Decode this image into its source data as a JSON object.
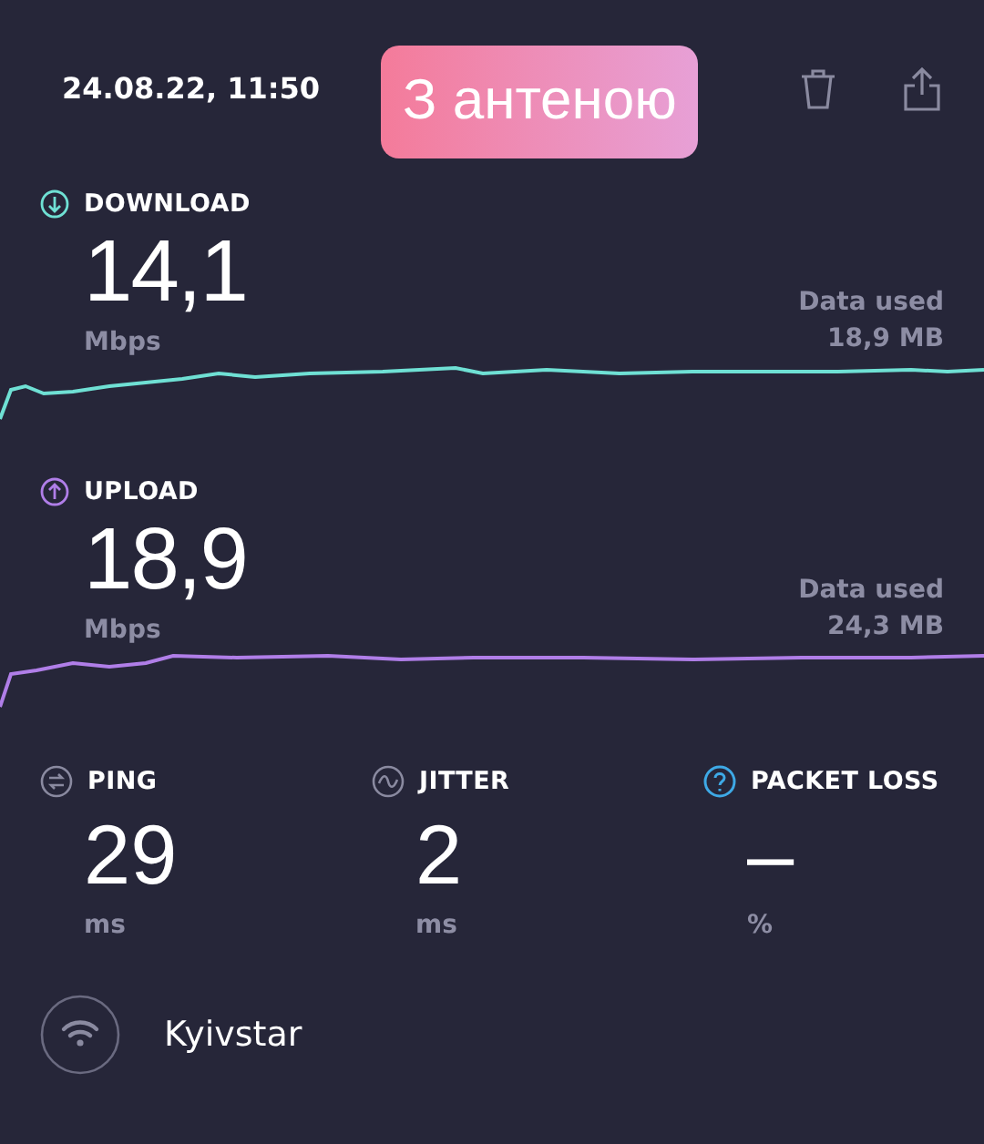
{
  "header": {
    "date": "24.08.22, 11:50",
    "banner": "З антеною"
  },
  "speeds": [
    {
      "kind": "download",
      "label": "DOWNLOAD",
      "value": "14,1",
      "unit": "Mbps",
      "data_label": "Data used",
      "data_value": "18,9 MB",
      "color": "#6fe0d4"
    },
    {
      "kind": "upload",
      "label": "UPLOAD",
      "value": "18,9",
      "unit": "Mbps",
      "data_label": "Data used",
      "data_value": "24,3 MB",
      "color": "#b07ee8"
    }
  ],
  "metrics": [
    {
      "kind": "ping",
      "label": "PING",
      "value": "29",
      "unit": "ms"
    },
    {
      "kind": "jitter",
      "label": "JITTER",
      "value": "2",
      "unit": "ms"
    },
    {
      "kind": "packet_loss",
      "label": "PACKET LOSS",
      "value": "–",
      "unit": "%"
    }
  ],
  "provider": {
    "name": "Kyivstar"
  }
}
